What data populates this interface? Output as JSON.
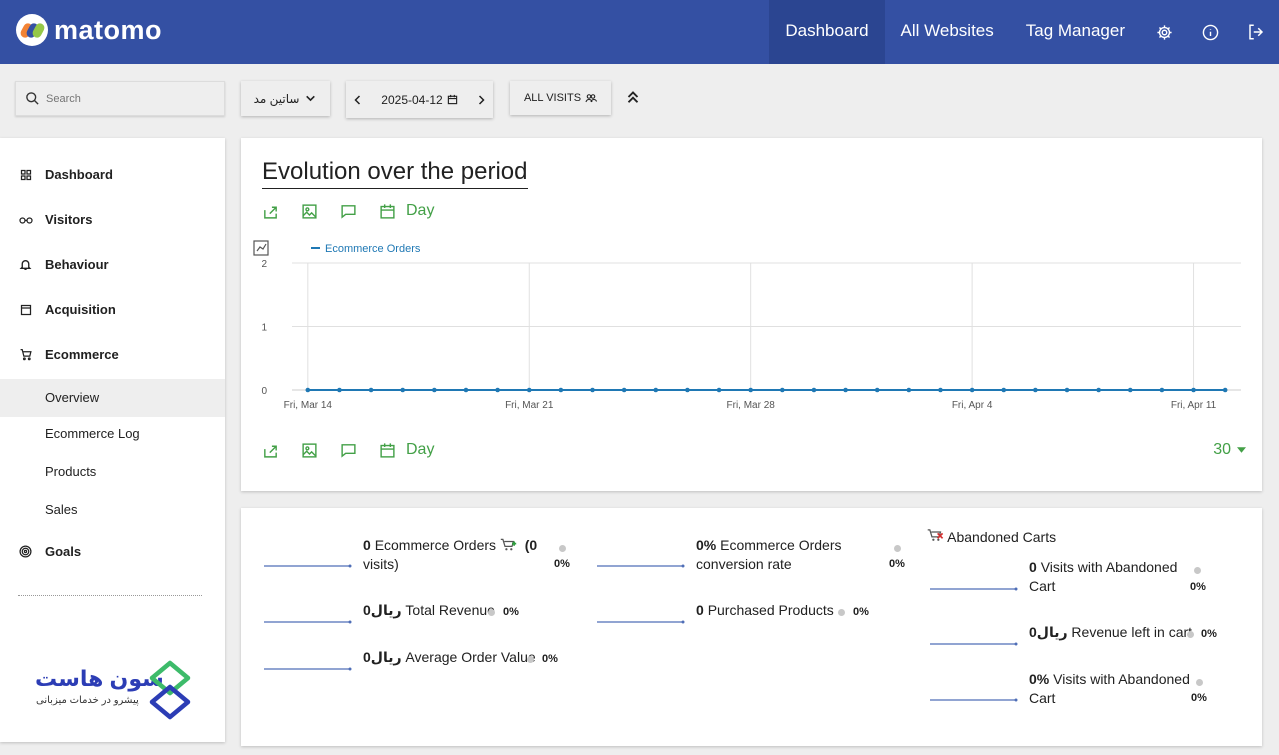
{
  "app": {
    "logo_text": "matomo"
  },
  "topnav": {
    "items": [
      {
        "label": "Dashboard",
        "active": true
      },
      {
        "label": "All Websites"
      },
      {
        "label": "Tag Manager"
      }
    ],
    "icons": [
      "gear-icon",
      "info-icon",
      "logout-icon"
    ]
  },
  "controls": {
    "search_placeholder": "Search",
    "site": "ساتین مد",
    "date": "2025-04-12",
    "segment": "ALL VISITS"
  },
  "sidebar": {
    "categories": [
      {
        "label": "Dashboard",
        "icon": "grid-icon"
      },
      {
        "label": "Visitors",
        "icon": "glasses-icon"
      },
      {
        "label": "Behaviour",
        "icon": "bell-icon"
      },
      {
        "label": "Acquisition",
        "icon": "window-icon"
      },
      {
        "label": "Ecommerce",
        "icon": "cart-icon"
      },
      {
        "label": "Goals",
        "icon": "target-icon"
      }
    ],
    "ecommerce_items": [
      {
        "label": "Overview",
        "active": true
      },
      {
        "label": "Ecommerce Log"
      },
      {
        "label": "Products"
      },
      {
        "label": "Sales"
      }
    ],
    "brand": {
      "name": "سون هاست",
      "tagline": "پیشرو در خدمات میزبانی"
    }
  },
  "evolution": {
    "title": "Evolution over the period",
    "period_label": "Day",
    "limit": "30"
  },
  "chart_data": {
    "type": "line",
    "series": [
      {
        "name": "Ecommerce Orders",
        "color": "#1f78b4",
        "values": [
          0,
          0,
          0,
          0,
          0,
          0,
          0,
          0,
          0,
          0,
          0,
          0,
          0,
          0,
          0,
          0,
          0,
          0,
          0,
          0,
          0,
          0,
          0,
          0,
          0,
          0,
          0,
          0,
          0,
          0
        ]
      }
    ],
    "x": [
      "2025-03-14",
      "2025-03-15",
      "2025-03-16",
      "2025-03-17",
      "2025-03-18",
      "2025-03-19",
      "2025-03-20",
      "2025-03-21",
      "2025-03-22",
      "2025-03-23",
      "2025-03-24",
      "2025-03-25",
      "2025-03-26",
      "2025-03-27",
      "2025-03-28",
      "2025-03-29",
      "2025-03-30",
      "2025-03-31",
      "2025-04-01",
      "2025-04-02",
      "2025-04-03",
      "2025-04-04",
      "2025-04-05",
      "2025-04-06",
      "2025-04-07",
      "2025-04-08",
      "2025-04-09",
      "2025-04-10",
      "2025-04-11",
      "2025-04-12"
    ],
    "x_tick_labels": [
      "Fri, Mar 14",
      "Fri, Mar 21",
      "Fri, Mar 28",
      "Fri, Apr 4",
      "Fri, Apr 11"
    ],
    "y_tick_labels": [
      "0",
      "1",
      "2"
    ],
    "ylim": [
      0,
      2
    ],
    "grid": true,
    "legend_position": "top-left"
  },
  "sparklines": {
    "col1": [
      {
        "value": "0",
        "label": "Ecommerce Orders",
        "extra": "(0",
        "extra2": "visits)",
        "delta": "0%"
      },
      {
        "value": "0ریال",
        "label": "Total Revenue",
        "delta": "0%"
      },
      {
        "value": "0ریال",
        "label": "Average Order Value",
        "delta": "0%"
      }
    ],
    "col2": [
      {
        "value": "0%",
        "label": "Ecommerce Orders",
        "label2": "conversion rate",
        "delta": "0%"
      },
      {
        "value": "0",
        "label": "Purchased Products",
        "delta": "0%"
      }
    ],
    "col3_title": "Abandoned Carts",
    "col3": [
      {
        "value": "0",
        "label": "Visits with Abandoned",
        "label2": "Cart",
        "delta": "0%"
      },
      {
        "value": "0ریال",
        "label": "Revenue left in cart",
        "delta": "0%"
      },
      {
        "value": "0%",
        "label": "Visits with Abandoned",
        "label2": "Cart",
        "delta": "0%"
      }
    ]
  }
}
